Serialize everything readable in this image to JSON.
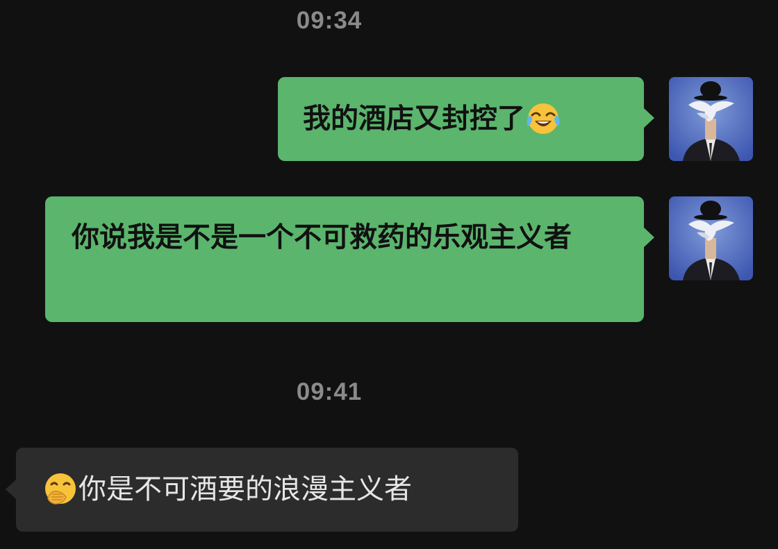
{
  "timestamps": [
    "09:34",
    "09:41"
  ],
  "messages": [
    {
      "direction": "outgoing",
      "text": "我的酒店又封控了",
      "emoji": "face-with-tears-of-joy"
    },
    {
      "direction": "outgoing",
      "text": "你说我是不是一个不可救药的乐观主义者"
    },
    {
      "direction": "incoming",
      "text": "你是不可酒要的浪漫主义者",
      "emoji": "hand-over-mouth"
    }
  ],
  "colors": {
    "background": "#111111",
    "outgoing_bubble": "#5bb56d",
    "incoming_bubble": "#2c2c2c",
    "timestamp": "#8a8a8a"
  }
}
